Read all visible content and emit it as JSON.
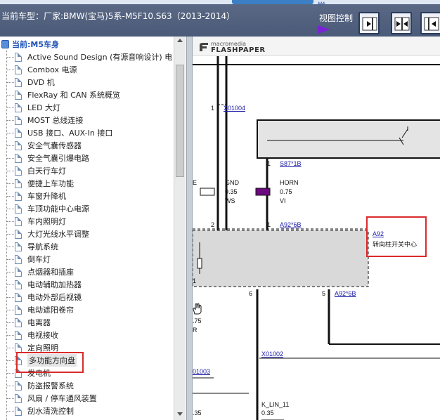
{
  "header": {
    "car_title": "当前车型：厂家:BMW(宝马)5系-M5F10.S63（2013-2014）",
    "view_control_label": "视图控制",
    "top_link_dots": "..."
  },
  "tree": {
    "root_label": "当前:M5车身",
    "items": [
      "Active Sound Design (有源音响设计) 电",
      "Combox 电源",
      "DVD 机",
      "FlexRay 和 CAN 系统概览",
      "LED 大灯",
      "MOST 总线连接",
      "USB 接口、AUX-In 接口",
      "安全气囊传感器",
      "安全气囊引爆电路",
      "白天行车灯",
      "便捷上车功能",
      "车窗升降机",
      "车顶功能中心电源",
      "车内照明灯",
      "大灯光线水平调整",
      "导航系统",
      "倒车灯",
      "点烟器和插座",
      "电动辅助加热器",
      "电动外部后视镜",
      "电动遮阳卷帘",
      "电离器",
      "电视接收",
      "定向照明",
      "多功能方向盘",
      "发电机",
      "防盗报警系统",
      "风扇 / 停车通风装置",
      "刮水清洗控制"
    ],
    "selected_index": 24
  },
  "doc": {
    "fp_small": "macromedia",
    "fp_big": "FLASHPAPER",
    "labels": {
      "x01004": "X01004",
      "s87": "S87*1B",
      "pin1_top": "1",
      "pin1_mid": "1",
      "pin2": "2",
      "pin6": "6",
      "pin5": "5",
      "pin1_left": "1",
      "gnd": "GND",
      "gnd_size": "0.35",
      "gnd_color": "WS",
      "horn": "HORN",
      "horn_size": "0.75",
      "horn_color": "VI",
      "e_mark": "E",
      "a92_6b_top": "A92*6B",
      "a92": "A92",
      "a92_desc": "转向柱开关中心",
      "a92_6b_bot": "A92*6B",
      "x01002": "X01002",
      "x01003": "01003",
      "k_lin": "K_LIN_11",
      "k_lin_size": "0.35",
      "left_75": ".75",
      "left_r": "R",
      "left_35": ".35"
    }
  },
  "colors": {
    "header_bg": "#4f5e7c",
    "selection_box": "#d92b2b",
    "link": "#1a1aa8",
    "arrow": "#7a22d6"
  }
}
